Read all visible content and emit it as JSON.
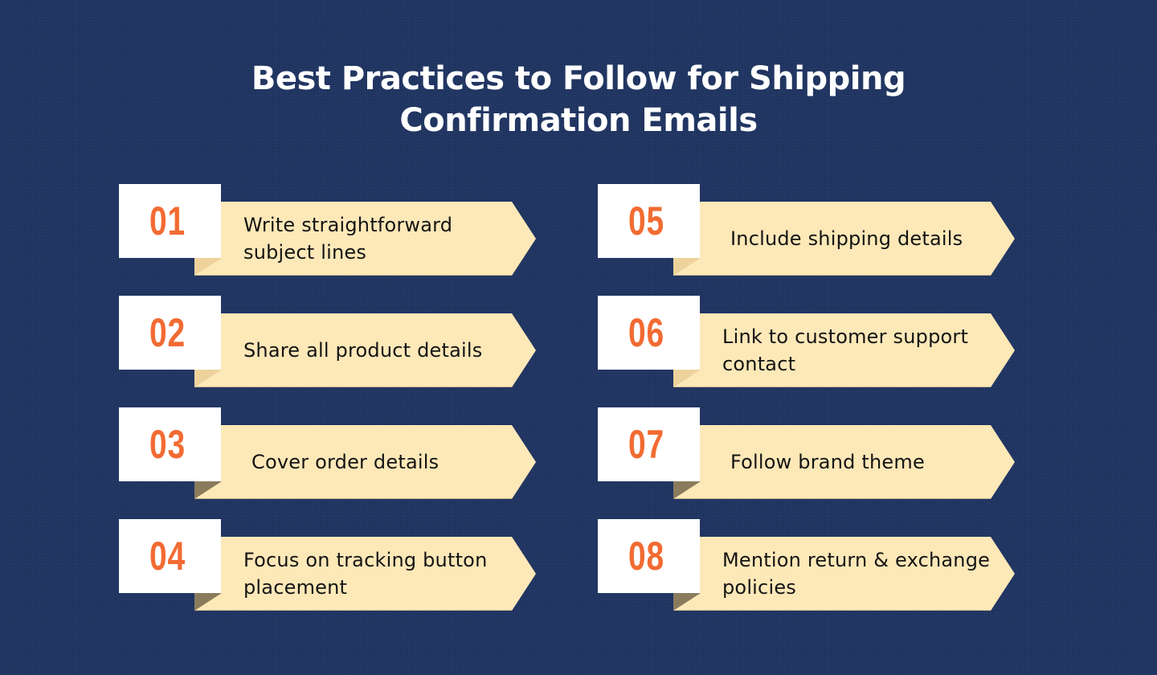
{
  "title": {
    "line1": "Best Practices to Follow for Shipping",
    "line2": "Confirmation Emails"
  },
  "colors": {
    "background": "#1f3461",
    "number": "#f26b32",
    "banner": "#fde8b8",
    "number_box": "#ffffff",
    "text": "#141414"
  },
  "items": [
    {
      "number": "01",
      "text": "Write straightforward subject lines"
    },
    {
      "number": "02",
      "text": "Share all product details"
    },
    {
      "number": "03",
      "text": "Cover order details"
    },
    {
      "number": "04",
      "text": "Focus on tracking button placement"
    },
    {
      "number": "05",
      "text": "Include shipping details"
    },
    {
      "number": "06",
      "text": "Link to customer support contact"
    },
    {
      "number": "07",
      "text": "Follow brand theme"
    },
    {
      "number": "08",
      "text": "Mention return & exchange policies"
    }
  ]
}
